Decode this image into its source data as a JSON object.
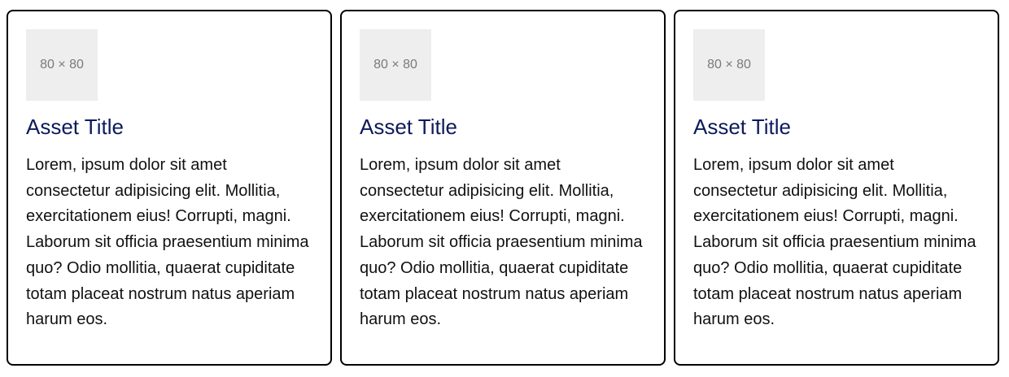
{
  "colors": {
    "title": "#0d1b5c",
    "text": "#111111",
    "border": "#000000",
    "placeholder_bg": "#eeeeee",
    "placeholder_text": "#7a7a7a"
  },
  "cards": [
    {
      "image_label": "80 × 80",
      "title": "Asset Title",
      "description": "Lorem, ipsum dolor sit amet consectetur adipisicing elit. Mollitia, exercitationem eius! Corrupti, magni. Laborum sit officia praesentium minima quo? Odio mollitia, quaerat cupiditate totam placeat nostrum natus aperiam harum eos."
    },
    {
      "image_label": "80 × 80",
      "title": "Asset Title",
      "description": "Lorem, ipsum dolor sit amet consectetur adipisicing elit. Mollitia, exercitationem eius! Corrupti, magni. Laborum sit officia praesentium minima quo? Odio mollitia, quaerat cupiditate totam placeat nostrum natus aperiam harum eos."
    },
    {
      "image_label": "80 × 80",
      "title": "Asset Title",
      "description": "Lorem, ipsum dolor sit amet consectetur adipisicing elit. Mollitia, exercitationem eius! Corrupti, magni. Laborum sit officia praesentium minima quo? Odio mollitia, quaerat cupiditate totam placeat nostrum natus aperiam harum eos."
    }
  ]
}
